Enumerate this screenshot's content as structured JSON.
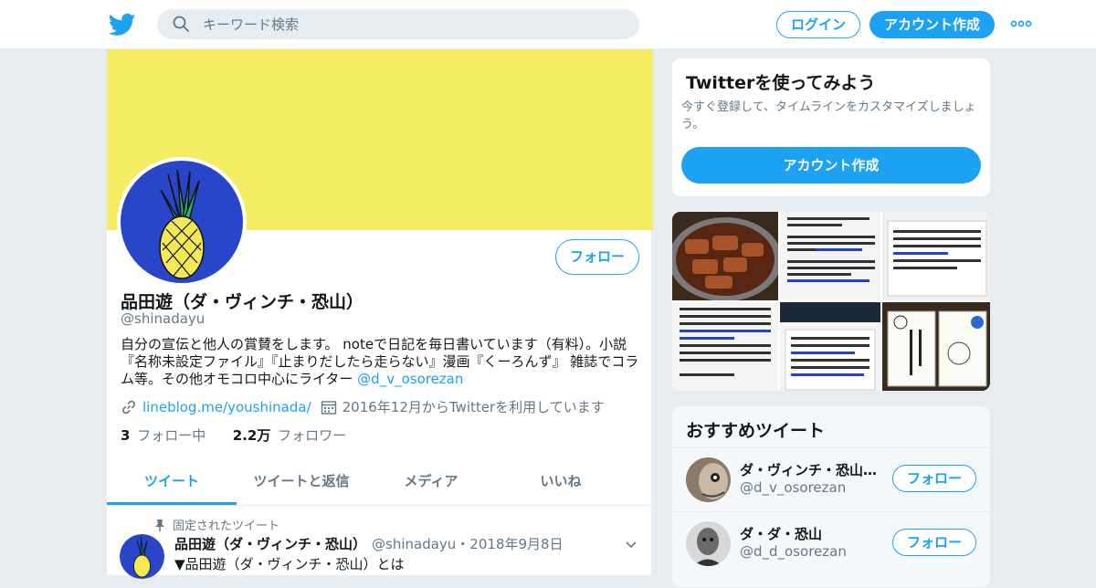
{
  "header": {
    "search_placeholder": "キーワード検索",
    "login_label": "ログイン",
    "signup_label": "アカウント作成"
  },
  "profile": {
    "follow_label": "フォロー",
    "name": "品田遊（ダ・ヴィンチ・恐山）",
    "handle": "@shinadayu",
    "bio_text": "自分の宣伝と他人の賞賛をします。 noteで日記を毎日書いています（有料）。小説『名称未設定ファイル』『止まりだしたら走らない』漫画『くーろんず』 雑誌でコラム等。その他オモコロ中心にライター ",
    "bio_mention": "@d_v_osorezan",
    "website": "lineblog.me/youshinada/",
    "joined": "2016年12月からTwitterを利用しています",
    "following_count": "3",
    "following_label": "フォロー中",
    "followers_count": "2.2万",
    "followers_label": "フォロワー",
    "colors": {
      "banner": "#f4ec62",
      "accent": "#1da1f2"
    }
  },
  "tabs": [
    {
      "label": "ツイート",
      "active": true
    },
    {
      "label": "ツイートと返信",
      "active": false
    },
    {
      "label": "メディア",
      "active": false
    },
    {
      "label": "いいね",
      "active": false
    }
  ],
  "pinned_tweet": {
    "pinned_label": "固定されたツイート",
    "author_name": "品田遊（ダ・ヴィンチ・恐山）",
    "meta": "@shinadayu・2018年9月8日",
    "text": "▼品田遊（ダ・ヴィンチ・恐山）とは"
  },
  "signup_card": {
    "title": "Twitterを使ってみよう",
    "description": "今すぐ登録して、タイムラインをカスタマイズしましょう。",
    "button_label": "アカウント作成"
  },
  "recommended": {
    "title": "おすすめツイート",
    "items": [
      {
        "name": "ダ・ヴィンチ・恐山…",
        "handle": "@d_v_osorezan",
        "follow_label": "フォロー"
      },
      {
        "name": "ダ・ダ・恐山",
        "handle": "@d_d_osorezan",
        "follow_label": "フォロー"
      }
    ]
  }
}
